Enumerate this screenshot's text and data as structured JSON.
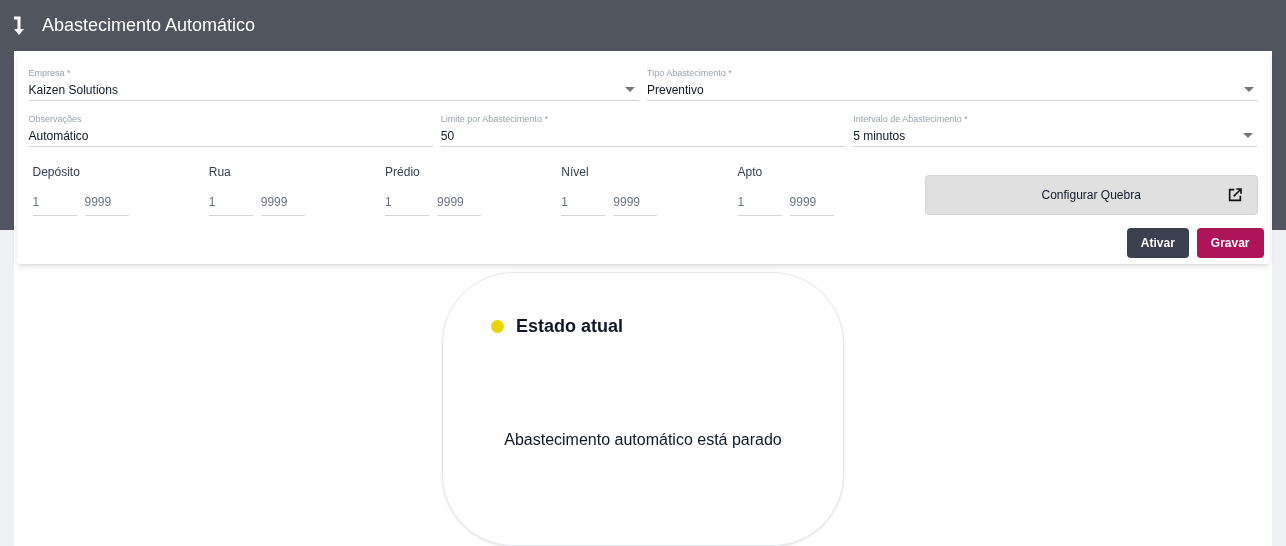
{
  "header": {
    "title": "Abastecimento Automático"
  },
  "form": {
    "rows": [
      [
        {
          "label": "Empresa *",
          "value": "Kaizen Solutions",
          "kind": "select"
        },
        {
          "label": "Tipo Abastecimento *",
          "value": "Preventivo",
          "kind": "select"
        }
      ],
      [
        {
          "label": "Observações",
          "value": "Automático",
          "kind": "text"
        },
        {
          "label": "Limite por Abastecimento *",
          "value": "50",
          "kind": "text"
        },
        {
          "label": "Intervalo de Abastecimento *",
          "value": "5 minutos",
          "kind": "select"
        }
      ]
    ],
    "ranges": [
      {
        "label": "Depósito",
        "from": "1",
        "to": "9999"
      },
      {
        "label": "Rua",
        "from": "1",
        "to": "9999"
      },
      {
        "label": "Prédio",
        "from": "1",
        "to": "9999"
      },
      {
        "label": "Nível",
        "from": "1",
        "to": "9999"
      },
      {
        "label": "Apto",
        "from": "1",
        "to": "9999"
      }
    ],
    "config_button": "Configurar Quebra",
    "actions": [
      {
        "label": "Ativar",
        "kind": "secondary"
      },
      {
        "label": "Gravar",
        "kind": "primary"
      }
    ]
  },
  "status": {
    "title": "Estado atual",
    "color": "#e8d400",
    "message": "Abastecimento automático está parado"
  }
}
